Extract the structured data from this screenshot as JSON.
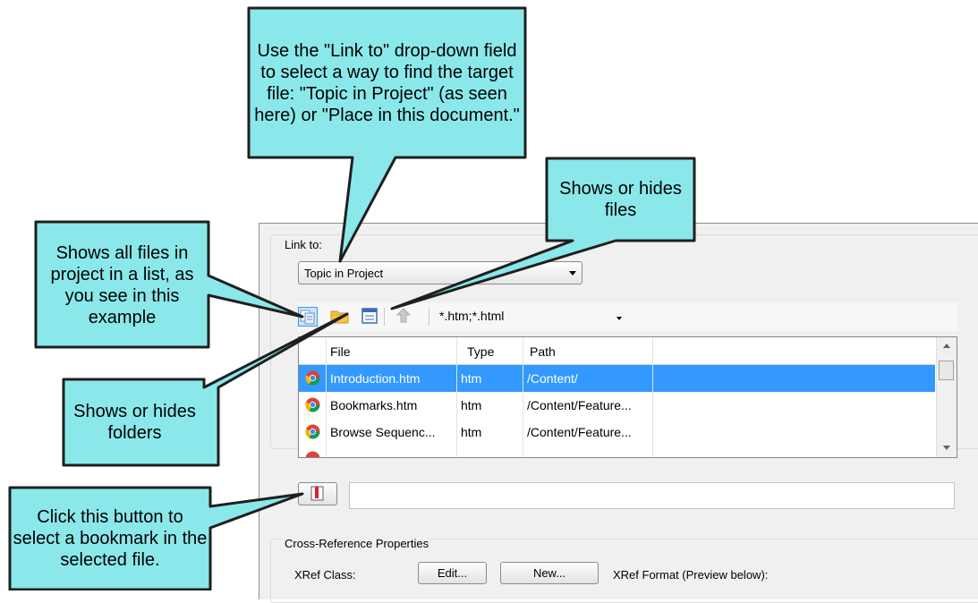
{
  "dialog": {
    "link_to_label": "Link to:",
    "link_to_value": "Topic in Project",
    "filter_value": "*.htm;*.html",
    "columns": [
      "File",
      "Type",
      "Path"
    ],
    "rows": [
      {
        "file": "Introduction.htm",
        "type": "htm",
        "path": "/Content/",
        "selected": true
      },
      {
        "file": "Bookmarks.htm",
        "type": "htm",
        "path": "/Content/Feature...",
        "selected": false
      },
      {
        "file": "Browse Sequenc...",
        "type": "htm",
        "path": "/Content/Feature...",
        "selected": false
      }
    ],
    "bookmark_value": "",
    "xref_group_label": "Cross-Reference Properties",
    "xref_class_label": "XRef Class:",
    "edit_button": "Edit...",
    "new_button": "New...",
    "xref_format_label": "XRef Format (Preview below):"
  },
  "callouts": {
    "link_to": "Use the \"Link to\" drop-down field to select a way to find the target file: \"Topic in Project\" (as seen here) or \"Place in this document.\"",
    "files": "Shows or hides files",
    "all_files": "Shows all files in project in a list, as you see in this example",
    "folders": "Shows or hides folders",
    "bookmark": "Click this button to select a bookmark in the selected file."
  },
  "colors": {
    "callout_fill": "#8ae8ea",
    "callout_border": "#1f1f1f",
    "selection": "#3399ff"
  },
  "icons": [
    "all-files-list-icon",
    "folder-icon",
    "files-toggle-icon",
    "up-level-icon",
    "browser-file-icon",
    "bookmark-icon"
  ]
}
